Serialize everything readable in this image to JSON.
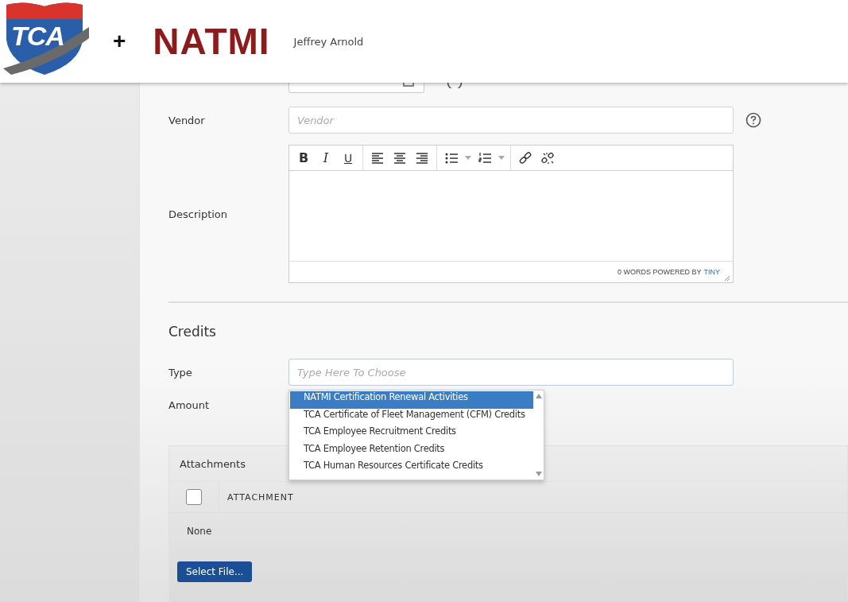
{
  "header": {
    "logo_text": "TCA",
    "plus": "+",
    "brand": "NATMI",
    "user": "Jeffrey Arnold"
  },
  "form": {
    "vendor": {
      "label": "Vendor",
      "placeholder": "Vendor"
    },
    "description": {
      "label": "Description",
      "toolbar": [
        [
          {
            "kind": "bold",
            "glyph": "B"
          },
          {
            "kind": "italic",
            "glyph": "I"
          },
          {
            "kind": "underline",
            "glyph": "U"
          }
        ],
        [
          {
            "kind": "align-left"
          },
          {
            "kind": "align-center"
          },
          {
            "kind": "align-right"
          }
        ],
        [
          {
            "kind": "bullet-list"
          },
          {
            "kind": "numbered-list"
          }
        ],
        [
          {
            "kind": "link"
          },
          {
            "kind": "unlink"
          }
        ]
      ],
      "status": "0 WORDS POWERED BY",
      "brand_link": "TINY"
    }
  },
  "credits": {
    "title": "Credits",
    "type": {
      "label": "Type",
      "placeholder": "Type Here To Choose"
    },
    "amount": {
      "label": "Amount"
    },
    "options": [
      {
        "label": "NATMI Certification Renewal Activities",
        "selected": true
      },
      {
        "label": "TCA Certificate of Fleet Management (CFM) Credits",
        "selected": false
      },
      {
        "label": "TCA Employee Recruitment Credits",
        "selected": false
      },
      {
        "label": "TCA Employee Retention Credits",
        "selected": false
      },
      {
        "label": "TCA Human Resources Certificate Credits",
        "selected": false
      }
    ]
  },
  "attachments": {
    "title": "Attachments",
    "select_all_checked": false,
    "columns": [
      "ATTACHMENT"
    ],
    "empty": "None",
    "button": "Select File..."
  }
}
